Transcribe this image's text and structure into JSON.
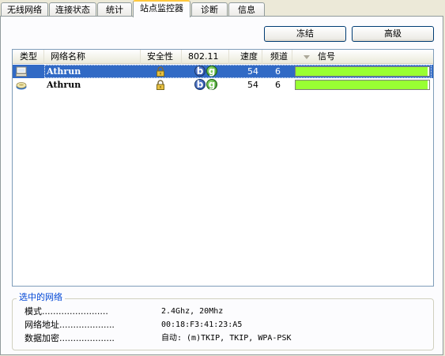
{
  "tabs": [
    {
      "label": "无线网络"
    },
    {
      "label": "连接状态"
    },
    {
      "label": "统计"
    },
    {
      "label": "站点监控器",
      "active": true
    },
    {
      "label": "诊断"
    },
    {
      "label": "信息"
    }
  ],
  "buttons": {
    "freeze": "冻结",
    "advanced": "高级"
  },
  "columns": {
    "type": "类型",
    "ssid": "网络名称",
    "security": "安全性",
    "mode": "802.11",
    "rate": "速度",
    "channel": "频道",
    "signal": "信号"
  },
  "rows": [
    {
      "ssid": "Athrun",
      "rate": "54",
      "channel": "6",
      "signal_fraction": 0.99,
      "selected": true,
      "badges": [
        "b",
        "g"
      ],
      "type_icon": "computer-network-icon"
    },
    {
      "ssid": "Athrun",
      "rate": "54",
      "channel": "6",
      "signal_fraction": 0.99,
      "selected": false,
      "badges": [
        "b",
        "g"
      ],
      "type_icon": "access-point-icon"
    }
  ],
  "selected_network": {
    "title": "选中的网络",
    "mode_label": "模式........................",
    "mode_value": "2.4Ghz, 20Mhz",
    "mac_label": "网络地址....................",
    "mac_value": "00:18:F3:41:23:A5",
    "encryption_label": "数据加密....................",
    "encryption_value": "自动: (m)TKIP, TKIP, WPA-PSK"
  },
  "colors": {
    "selection": "#316ac5",
    "signal_bar": "#99ff33",
    "group_title": "#0046d5",
    "active_tab_accent": "#ffc83c"
  }
}
